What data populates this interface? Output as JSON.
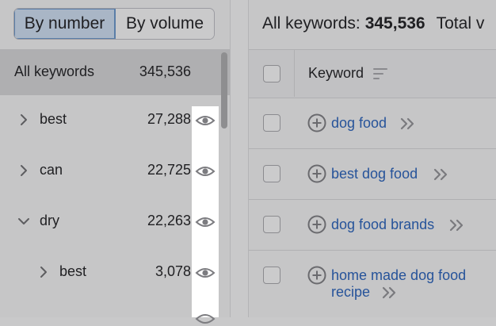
{
  "toggle": {
    "by_number": "By number",
    "by_volume": "By volume"
  },
  "left": {
    "all_label": "All keywords",
    "all_count": "345,536",
    "rows": [
      {
        "label": "best",
        "count": "27,288",
        "expanded": false
      },
      {
        "label": "can",
        "count": "22,725",
        "expanded": false
      },
      {
        "label": "dry",
        "count": "22,263",
        "expanded": true
      },
      {
        "label": "best",
        "count": "3,078",
        "expanded": false
      }
    ]
  },
  "right": {
    "summary_label": "All keywords:",
    "summary_count": "345,536",
    "summary_total": "Total v",
    "column_keyword": "Keyword",
    "keywords": [
      {
        "line1": "dog food",
        "line2": ""
      },
      {
        "line1": "best dog food",
        "line2": ""
      },
      {
        "line1": "dog food brands",
        "line2": ""
      },
      {
        "line1": "home made dog food",
        "line2": "recipe"
      }
    ]
  },
  "icons": {
    "expand": "chevron-right-icon",
    "collapse": "chevron-down-icon",
    "visibility": "eye-icon",
    "sort": "sort-icon",
    "add": "plus-circle-icon",
    "more": "double-chevron-icon"
  },
  "colors": {
    "link": "#26539a",
    "active_toggle": "#a9b6c6",
    "accent_border": "#5a7ea8"
  }
}
